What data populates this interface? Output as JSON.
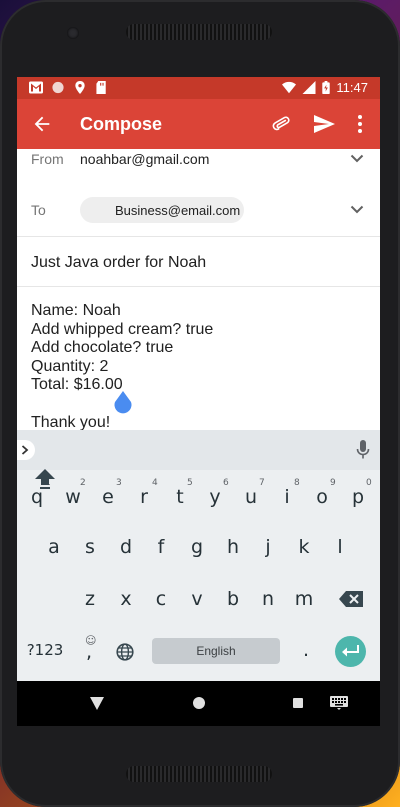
{
  "status_bar": {
    "time": "11:47",
    "icons": [
      "gmail-notification-icon",
      "circle-notification-icon",
      "location-icon",
      "sd-card-icon",
      "wifi-icon",
      "signal-icon",
      "battery-icon"
    ]
  },
  "app_bar": {
    "title": "Compose",
    "icons": [
      "back-arrow-icon",
      "attachment-icon",
      "send-icon",
      "more-vert-icon"
    ]
  },
  "compose": {
    "from_label": "From",
    "from_value": "noahbar@gmail.com",
    "to_label": "To",
    "to_chip": "Business@email.com",
    "subject": "Just Java order for Noah",
    "body_lines": [
      "Name: Noah",
      "Add whipped cream? true",
      "Add chocolate? true",
      "Quantity: 2",
      "Total: $16.00",
      "",
      "Thank you!"
    ]
  },
  "keyboard": {
    "row1": [
      "q",
      "w",
      "e",
      "r",
      "t",
      "y",
      "u",
      "i",
      "o",
      "p"
    ],
    "row1_hints": [
      "1",
      "2",
      "3",
      "4",
      "5",
      "6",
      "7",
      "8",
      "9",
      "0"
    ],
    "row2": [
      "a",
      "s",
      "d",
      "f",
      "g",
      "h",
      "j",
      "k",
      "l"
    ],
    "row3": [
      "z",
      "x",
      "c",
      "v",
      "b",
      "n",
      "m"
    ],
    "symbols_label": "?123",
    "comma_label": ",",
    "emoji_hint": "☺",
    "space_label": "English",
    "period_label": ".",
    "colors": {
      "enter_key": "#4db6ac",
      "app_bar": "#db4437",
      "status_bar": "#c53929"
    }
  },
  "nav_bar": {
    "icons": [
      "nav-back-icon",
      "nav-home-icon",
      "nav-recents-icon",
      "keyboard-switch-icon"
    ]
  }
}
